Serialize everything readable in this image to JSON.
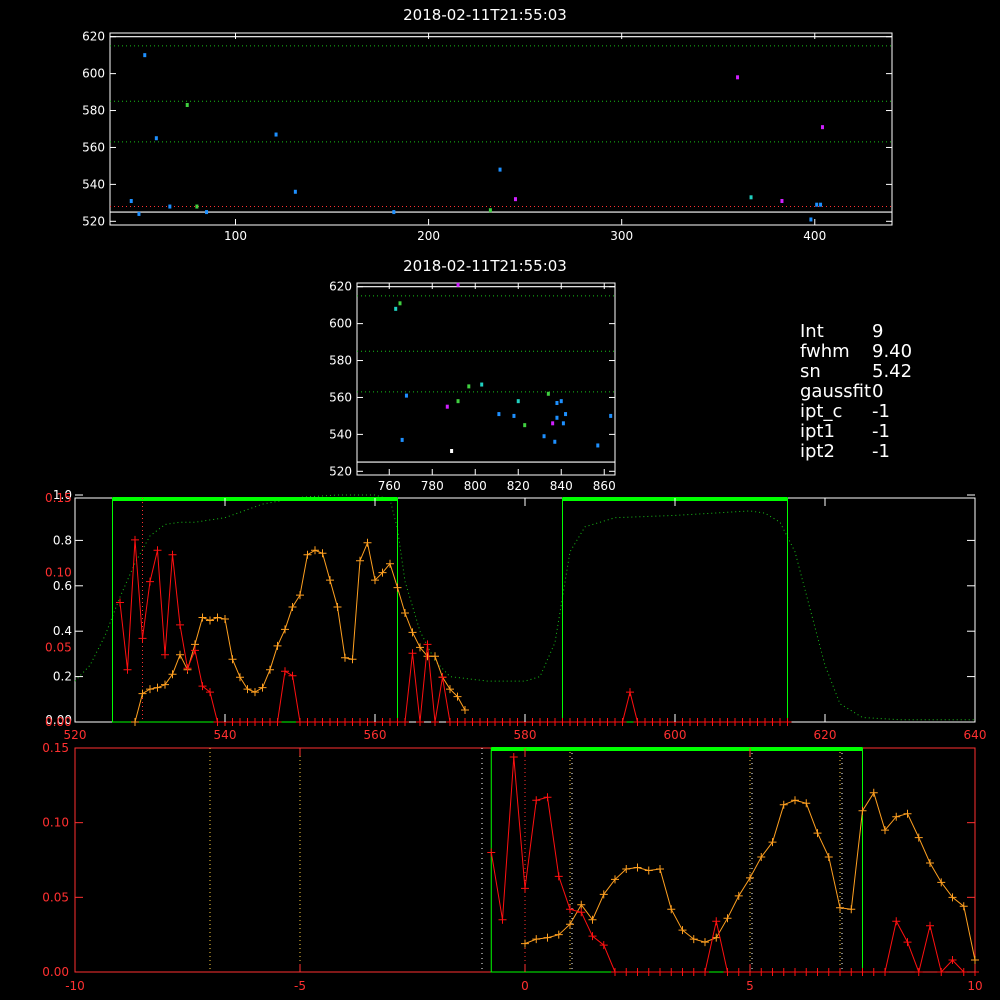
{
  "colors": {
    "background": "#000000",
    "axis_white": "#ffffff",
    "axis_red": "#ff2020",
    "ref_green": "#00ff00",
    "dotted_green": "#18c018",
    "line_orange": "#ffa020",
    "line_red": "#ff1010",
    "point_blue": "#1e90ff",
    "point_magenta": "#d020ff",
    "point_teal": "#20d0c0",
    "point_green": "#40d040",
    "point_white": "#ffffff"
  },
  "info": [
    {
      "key": "Int",
      "value": "9"
    },
    {
      "key": "fwhm",
      "value": "9.40"
    },
    {
      "key": "sn",
      "value": "5.42"
    },
    {
      "key": "gaussfit",
      "value": "0"
    },
    {
      "key": "ipt_c",
      "value": "-1"
    },
    {
      "key": "ipt1",
      "value": "-1"
    },
    {
      "key": "ipt2",
      "value": "-1"
    }
  ],
  "chart_data": [
    {
      "type": "scatter",
      "title": "2018-02-11T21:55:03",
      "xlim": [
        35,
        440
      ],
      "ylim": [
        518,
        622
      ],
      "xticks": [
        100,
        200,
        300,
        400
      ],
      "yticks": [
        520,
        540,
        560,
        580,
        600,
        620
      ],
      "hlines_dotted": [
        528,
        563,
        585,
        615
      ],
      "hlines_solid": [
        525,
        620
      ],
      "points": [
        {
          "x": 46,
          "y": 531,
          "c": "point_blue"
        },
        {
          "x": 50,
          "y": 524,
          "c": "point_blue"
        },
        {
          "x": 53,
          "y": 610,
          "c": "point_blue"
        },
        {
          "x": 59,
          "y": 565,
          "c": "point_blue"
        },
        {
          "x": 66,
          "y": 528,
          "c": "point_blue"
        },
        {
          "x": 75,
          "y": 583,
          "c": "point_green"
        },
        {
          "x": 80,
          "y": 528,
          "c": "point_green"
        },
        {
          "x": 85,
          "y": 525,
          "c": "point_blue"
        },
        {
          "x": 121,
          "y": 567,
          "c": "point_blue"
        },
        {
          "x": 131,
          "y": 536,
          "c": "point_blue"
        },
        {
          "x": 182,
          "y": 525,
          "c": "point_blue"
        },
        {
          "x": 232,
          "y": 526,
          "c": "point_green"
        },
        {
          "x": 237,
          "y": 548,
          "c": "point_blue"
        },
        {
          "x": 245,
          "y": 532,
          "c": "point_magenta"
        },
        {
          "x": 360,
          "y": 598,
          "c": "point_magenta"
        },
        {
          "x": 367,
          "y": 533,
          "c": "point_teal"
        },
        {
          "x": 383,
          "y": 531,
          "c": "point_magenta"
        },
        {
          "x": 398,
          "y": 521,
          "c": "point_blue"
        },
        {
          "x": 401,
          "y": 529,
          "c": "point_blue"
        },
        {
          "x": 403,
          "y": 529,
          "c": "point_blue"
        },
        {
          "x": 404,
          "y": 571,
          "c": "point_magenta"
        }
      ]
    },
    {
      "type": "scatter",
      "title": "2018-02-11T21:55:03",
      "xlim": [
        745,
        865
      ],
      "ylim": [
        518,
        622
      ],
      "xticks": [
        760,
        780,
        800,
        820,
        840,
        860
      ],
      "yticks": [
        520,
        540,
        560,
        580,
        600,
        620
      ],
      "hlines_dotted": [
        563,
        585,
        615
      ],
      "hlines_solid": [
        525,
        620
      ],
      "points": [
        {
          "x": 763,
          "y": 608,
          "c": "point_teal"
        },
        {
          "x": 765,
          "y": 611,
          "c": "point_green"
        },
        {
          "x": 766,
          "y": 537,
          "c": "point_blue"
        },
        {
          "x": 768,
          "y": 561,
          "c": "point_blue"
        },
        {
          "x": 787,
          "y": 555,
          "c": "point_magenta"
        },
        {
          "x": 789,
          "y": 531,
          "c": "point_white"
        },
        {
          "x": 792,
          "y": 558,
          "c": "point_green"
        },
        {
          "x": 797,
          "y": 566,
          "c": "point_green"
        },
        {
          "x": 803,
          "y": 567,
          "c": "point_teal"
        },
        {
          "x": 792,
          "y": 621,
          "c": "point_magenta"
        },
        {
          "x": 811,
          "y": 551,
          "c": "point_blue"
        },
        {
          "x": 818,
          "y": 550,
          "c": "point_blue"
        },
        {
          "x": 820,
          "y": 558,
          "c": "point_teal"
        },
        {
          "x": 823,
          "y": 545,
          "c": "point_green"
        },
        {
          "x": 832,
          "y": 539,
          "c": "point_blue"
        },
        {
          "x": 834,
          "y": 562,
          "c": "point_green"
        },
        {
          "x": 836,
          "y": 546,
          "c": "point_magenta"
        },
        {
          "x": 837,
          "y": 536,
          "c": "point_blue"
        },
        {
          "x": 838,
          "y": 549,
          "c": "point_blue"
        },
        {
          "x": 838,
          "y": 557,
          "c": "point_blue"
        },
        {
          "x": 840,
          "y": 558,
          "c": "point_blue"
        },
        {
          "x": 841,
          "y": 546,
          "c": "point_blue"
        },
        {
          "x": 842,
          "y": 551,
          "c": "point_blue"
        },
        {
          "x": 857,
          "y": 534,
          "c": "point_blue"
        },
        {
          "x": 863,
          "y": 550,
          "c": "point_blue"
        }
      ]
    },
    {
      "type": "line",
      "xlim": [
        520,
        640
      ],
      "xticks": [
        520,
        540,
        560,
        580,
        600,
        620,
        640
      ],
      "left_axis_white": {
        "ylim": [
          0,
          1.0
        ],
        "ticks": [
          0.2,
          0.4,
          0.6,
          0.8,
          1.0
        ],
        "labels": [
          "0.2",
          "0.4",
          "0.6",
          "0.8",
          "1.0"
        ]
      },
      "right_axis_white": {
        "ylim": [
          0,
          1.0
        ],
        "ticks": [
          0.2,
          0.4,
          0.6,
          0.8,
          1.0
        ]
      },
      "left_axis_red": {
        "ylim": [
          0,
          0.15
        ],
        "ticks": [
          0.0,
          0.05,
          0.1,
          0.15
        ],
        "labels": [
          "0.00",
          "0.05",
          "0.10",
          "0.15"
        ]
      },
      "extra_white_label": "0.00",
      "green_boxes": [
        [
          525,
          563
        ],
        [
          585,
          615
        ]
      ],
      "red_dotted_x": [
        529
      ],
      "transmission_dotted": {
        "x": [
          520,
          522,
          524,
          526,
          528,
          530,
          532,
          534,
          536,
          540,
          545,
          550,
          555,
          560,
          562,
          563,
          564,
          566,
          568,
          570,
          575,
          580,
          582,
          584,
          585,
          586,
          588,
          592,
          600,
          605,
          610,
          612,
          614,
          616,
          618,
          620,
          622,
          625,
          630,
          635,
          640
        ],
        "y": [
          0.18,
          0.25,
          0.38,
          0.55,
          0.7,
          0.82,
          0.87,
          0.88,
          0.88,
          0.9,
          0.96,
          0.99,
          1.0,
          1.0,
          0.98,
          0.85,
          0.62,
          0.4,
          0.27,
          0.2,
          0.18,
          0.18,
          0.2,
          0.35,
          0.55,
          0.75,
          0.86,
          0.9,
          0.91,
          0.92,
          0.93,
          0.92,
          0.88,
          0.75,
          0.5,
          0.25,
          0.08,
          0.02,
          0.01,
          0.01,
          0.01
        ]
      },
      "series": [
        {
          "color": "line_orange",
          "x": [
            528,
            529,
            530,
            531,
            532,
            533,
            534,
            535,
            536,
            537,
            538,
            539,
            540,
            541,
            542,
            543,
            544,
            545,
            546,
            547,
            548,
            549,
            550,
            551,
            552,
            553,
            554,
            555,
            556,
            557,
            558,
            559,
            560,
            561,
            562,
            563,
            564,
            565,
            566,
            567,
            568,
            569,
            570,
            571,
            572
          ],
          "y": [
            0.0,
            0.019,
            0.022,
            0.023,
            0.025,
            0.032,
            0.045,
            0.035,
            0.052,
            0.07,
            0.068,
            0.07,
            0.069,
            0.042,
            0.03,
            0.022,
            0.02,
            0.023,
            0.035,
            0.051,
            0.062,
            0.077,
            0.085,
            0.112,
            0.115,
            0.113,
            0.095,
            0.077,
            0.043,
            0.042,
            0.108,
            0.12,
            0.095,
            0.1,
            0.106,
            0.09,
            0.073,
            0.06,
            0.05,
            0.044,
            0.044,
            0.03,
            0.022,
            0.017,
            0.008
          ]
        },
        {
          "color": "line_red",
          "x": [
            526,
            527,
            528,
            529,
            530,
            531,
            532,
            533,
            534,
            535,
            536,
            537,
            538,
            539,
            540,
            541,
            542,
            543,
            544,
            545,
            546,
            547,
            548,
            549,
            550,
            551,
            552,
            553,
            554,
            555,
            556,
            557,
            558,
            559,
            560,
            561,
            562,
            563,
            564,
            565,
            566,
            567,
            568,
            569,
            570,
            571,
            572,
            573,
            574,
            575,
            576,
            577,
            578,
            579,
            580,
            581,
            582,
            583,
            584,
            585,
            586,
            587,
            588,
            589,
            590,
            591,
            592,
            593,
            594,
            595,
            596,
            597,
            598,
            599,
            600,
            601,
            602,
            603,
            604,
            605,
            606,
            607,
            608,
            609,
            610,
            611,
            612,
            613,
            614,
            615
          ],
          "y": [
            0.08,
            0.035,
            0.122,
            0.056,
            0.094,
            0.115,
            0.045,
            0.112,
            0.065,
            0.036,
            0.048,
            0.024,
            0.02,
            0.0,
            0.0,
            0.0,
            0.0,
            0.0,
            0.0,
            0.0,
            0.0,
            0.0,
            0.034,
            0.031,
            0.0,
            0.0,
            0.0,
            0.0,
            0.0,
            0.0,
            0.0,
            0.0,
            0.0,
            0.0,
            0.0,
            0.0,
            0.0,
            0.0,
            0.0,
            0.046,
            0.0,
            0.052,
            0.0,
            0.03,
            0.0,
            0.0,
            0.0,
            0.0,
            0.0,
            0.0,
            0.0,
            0.0,
            0.0,
            0.0,
            0.0,
            0.0,
            0.0,
            0.0,
            0.0,
            0.0,
            0.0,
            0.0,
            0.0,
            0.0,
            0.0,
            0.0,
            0.0,
            0.0,
            0.02,
            0.0,
            0.0,
            0.0,
            0.0,
            0.0,
            0.0,
            0.0,
            0.0,
            0.0,
            0.0,
            0.0,
            0.0,
            0.0,
            0.0,
            0.0,
            0.0,
            0.0,
            0.0,
            0.0,
            0.0,
            0.0
          ]
        }
      ]
    },
    {
      "type": "line",
      "xlim": [
        -10,
        10
      ],
      "xticks": [
        -10,
        -5,
        0,
        5,
        10
      ],
      "ylim": [
        0,
        0.15
      ],
      "yticks": [
        0.0,
        0.05,
        0.1,
        0.15
      ],
      "ylabels": [
        "0.00",
        "0.05",
        "0.10",
        "0.15"
      ],
      "green_box": [
        -0.75,
        7.5
      ],
      "vlines_dotted_yellow": [
        -7,
        -5,
        1,
        5,
        7
      ],
      "vlines_dotted_white": [
        -1,
        1,
        5,
        7
      ],
      "red_dotted_x": [
        0
      ],
      "series": [
        {
          "color": "line_orange",
          "x": [
            0.0,
            0.25,
            0.5,
            0.75,
            1.0,
            1.25,
            1.5,
            1.75,
            2.0,
            2.25,
            2.5,
            2.75,
            3.0,
            3.25,
            3.5,
            3.75,
            4.0,
            4.25,
            4.5,
            4.75,
            5.0,
            5.25,
            5.5,
            5.75,
            6.0,
            6.25,
            6.5,
            6.75,
            7.0,
            7.25,
            7.5,
            7.75,
            8.0,
            8.25,
            8.5,
            8.75,
            9.0,
            9.25,
            9.5,
            9.75,
            10.0
          ],
          "y": [
            0.019,
            0.022,
            0.023,
            0.025,
            0.032,
            0.045,
            0.035,
            0.052,
            0.062,
            0.069,
            0.07,
            0.068,
            0.069,
            0.042,
            0.028,
            0.022,
            0.02,
            0.023,
            0.036,
            0.051,
            0.063,
            0.077,
            0.087,
            0.112,
            0.115,
            0.113,
            0.093,
            0.077,
            0.043,
            0.042,
            0.108,
            0.12,
            0.095,
            0.104,
            0.106,
            0.09,
            0.073,
            0.06,
            0.05,
            0.044,
            0.008
          ]
        },
        {
          "color": "line_red",
          "x": [
            -0.75,
            -0.5,
            -0.25,
            0.0,
            0.25,
            0.5,
            0.75,
            1.0,
            1.25,
            1.5,
            1.75,
            2.0,
            2.25,
            2.5,
            2.75,
            3.0,
            3.25,
            3.5,
            3.75,
            4.0,
            4.25,
            4.5,
            4.75,
            5.0,
            5.25,
            5.5,
            5.75,
            6.0,
            6.25,
            6.5,
            6.75,
            7.0,
            7.25,
            7.5,
            7.75,
            8.0,
            8.25,
            8.5,
            8.75,
            9.0,
            9.25,
            9.5,
            9.75,
            10.0
          ],
          "y": [
            0.08,
            0.035,
            0.144,
            0.056,
            0.115,
            0.117,
            0.064,
            0.042,
            0.04,
            0.024,
            0.018,
            0.0,
            0.0,
            0.0,
            0.0,
            0.0,
            0.0,
            0.0,
            0.0,
            0.0,
            0.034,
            0.0,
            0.0,
            0.0,
            0.0,
            0.0,
            0.0,
            0.0,
            0.0,
            0.0,
            0.0,
            0.0,
            0.0,
            0.0,
            0.0,
            0.0,
            0.034,
            0.02,
            0.0,
            0.031,
            0.0,
            0.008,
            0.0,
            0.0
          ]
        }
      ]
    }
  ]
}
